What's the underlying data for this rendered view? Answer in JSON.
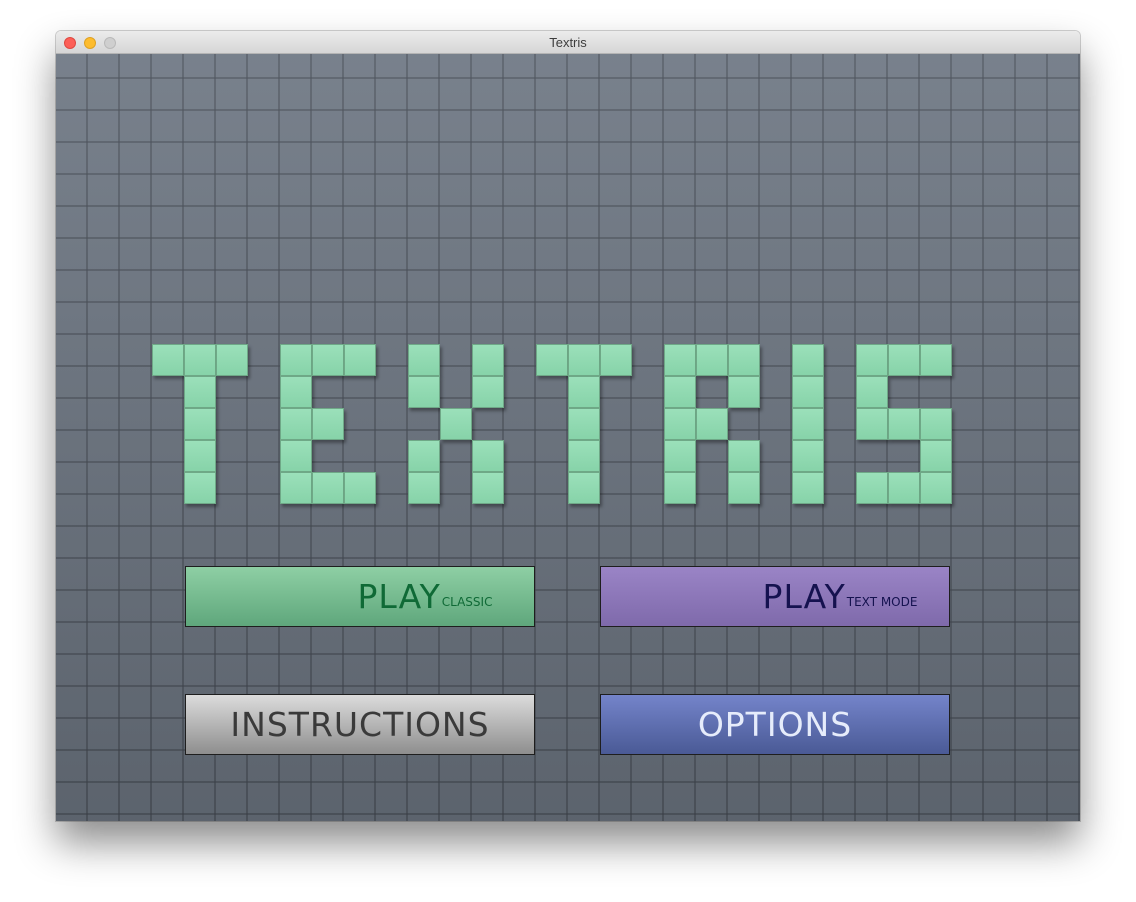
{
  "window": {
    "title": "Textris"
  },
  "logo": {
    "text": "TEXTRIS"
  },
  "menu": {
    "play_classic": {
      "label": "PLAY",
      "sublabel": "CLASSIC"
    },
    "play_text_mode": {
      "label": "PLAY",
      "sublabel": "TEXT MODE"
    },
    "instructions": {
      "label": "INSTRUCTIONS"
    },
    "options": {
      "label": "OPTIONS"
    }
  },
  "colors": {
    "block_green": "#93dbb4",
    "background_slate": "#707985",
    "classic_button": "#77bd90",
    "text_mode_button": "#8e78ba",
    "instructions_button": "#b5b5b5",
    "options_button": "#5f70b0"
  },
  "icons": {
    "close": "close-icon",
    "minimize": "minimize-icon",
    "zoom": "zoom-icon"
  }
}
